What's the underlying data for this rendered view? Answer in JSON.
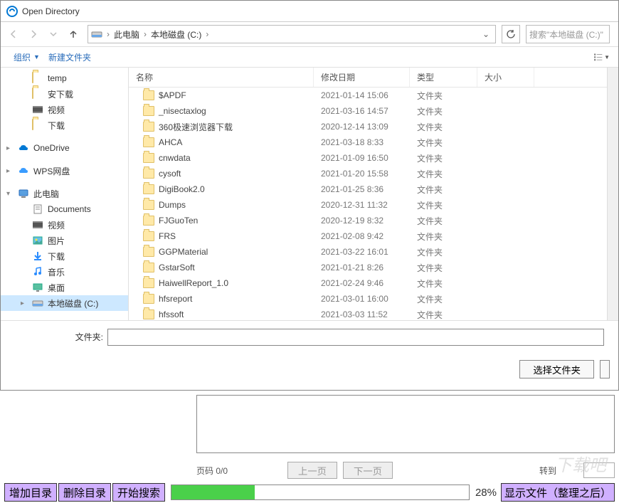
{
  "window": {
    "title": "Open Directory"
  },
  "nav": {
    "breadcrumb": [
      "此电脑",
      "本地磁盘 (C:)"
    ],
    "search_placeholder": "搜索\"本地磁盘 (C:)\""
  },
  "toolbar": {
    "organize": "组织",
    "new_folder": "新建文件夹"
  },
  "sidebar": {
    "items": [
      {
        "label": "temp",
        "type": "folder",
        "level": 2
      },
      {
        "label": "安下载",
        "type": "folder",
        "level": 2
      },
      {
        "label": "视频",
        "type": "video",
        "level": 2
      },
      {
        "label": "下载",
        "type": "folder",
        "level": 2
      },
      {
        "spacer": true
      },
      {
        "label": "OneDrive",
        "type": "onedrive",
        "level": 1,
        "chev": "right"
      },
      {
        "spacer": true
      },
      {
        "label": "WPS网盘",
        "type": "wps",
        "level": 1,
        "chev": "right"
      },
      {
        "spacer": true
      },
      {
        "label": "此电脑",
        "type": "thispc",
        "level": 1,
        "chev": "down"
      },
      {
        "label": "Documents",
        "type": "doc",
        "level": 2
      },
      {
        "label": "视频",
        "type": "video",
        "level": 2
      },
      {
        "label": "图片",
        "type": "picture",
        "level": 2
      },
      {
        "label": "下载",
        "type": "download",
        "level": 2
      },
      {
        "label": "音乐",
        "type": "music",
        "level": 2
      },
      {
        "label": "桌面",
        "type": "desktop",
        "level": 2
      },
      {
        "label": "本地磁盘 (C:)",
        "type": "disk",
        "level": 2,
        "chev": "right",
        "selected": true
      }
    ]
  },
  "columns": {
    "name": "名称",
    "date": "修改日期",
    "type": "类型",
    "size": "大小"
  },
  "files": [
    {
      "name": "$APDF",
      "date": "2021-01-14 15:06",
      "type": "文件夹"
    },
    {
      "name": "_nisectaxlog",
      "date": "2021-03-16 14:57",
      "type": "文件夹"
    },
    {
      "name": "360极速浏览器下载",
      "date": "2020-12-14 13:09",
      "type": "文件夹"
    },
    {
      "name": "AHCA",
      "date": "2021-03-18 8:33",
      "type": "文件夹"
    },
    {
      "name": "cnwdata",
      "date": "2021-01-09 16:50",
      "type": "文件夹"
    },
    {
      "name": "cysoft",
      "date": "2021-01-20 15:58",
      "type": "文件夹"
    },
    {
      "name": "DigiBook2.0",
      "date": "2021-01-25 8:36",
      "type": "文件夹"
    },
    {
      "name": "Dumps",
      "date": "2020-12-31 11:32",
      "type": "文件夹"
    },
    {
      "name": "FJGuoTen",
      "date": "2020-12-19 8:32",
      "type": "文件夹"
    },
    {
      "name": "FRS",
      "date": "2021-02-08 9:42",
      "type": "文件夹"
    },
    {
      "name": "GGPMaterial",
      "date": "2021-03-22 16:01",
      "type": "文件夹"
    },
    {
      "name": "GstarSoft",
      "date": "2021-01-21 8:26",
      "type": "文件夹"
    },
    {
      "name": "HaiwellReport_1.0",
      "date": "2021-02-24 9:46",
      "type": "文件夹"
    },
    {
      "name": "hfsreport",
      "date": "2021-03-01 16:00",
      "type": "文件夹"
    },
    {
      "name": "hfssoft",
      "date": "2021-03-03 11:52",
      "type": "文件夹"
    }
  ],
  "filename": {
    "label": "文件夹:",
    "value": ""
  },
  "buttons": {
    "select_folder": "选择文件夹"
  },
  "pager": {
    "label": "页码 0/0",
    "prev": "上一页",
    "next": "下一页",
    "goto": "转到",
    "goto_value": ""
  },
  "actions": {
    "add_dir": "增加目录",
    "del_dir": "删除目录",
    "start_search": "开始搜索",
    "show_files": "显示文件（整理之后）",
    "progress_pct": "28%"
  },
  "progress": 28
}
